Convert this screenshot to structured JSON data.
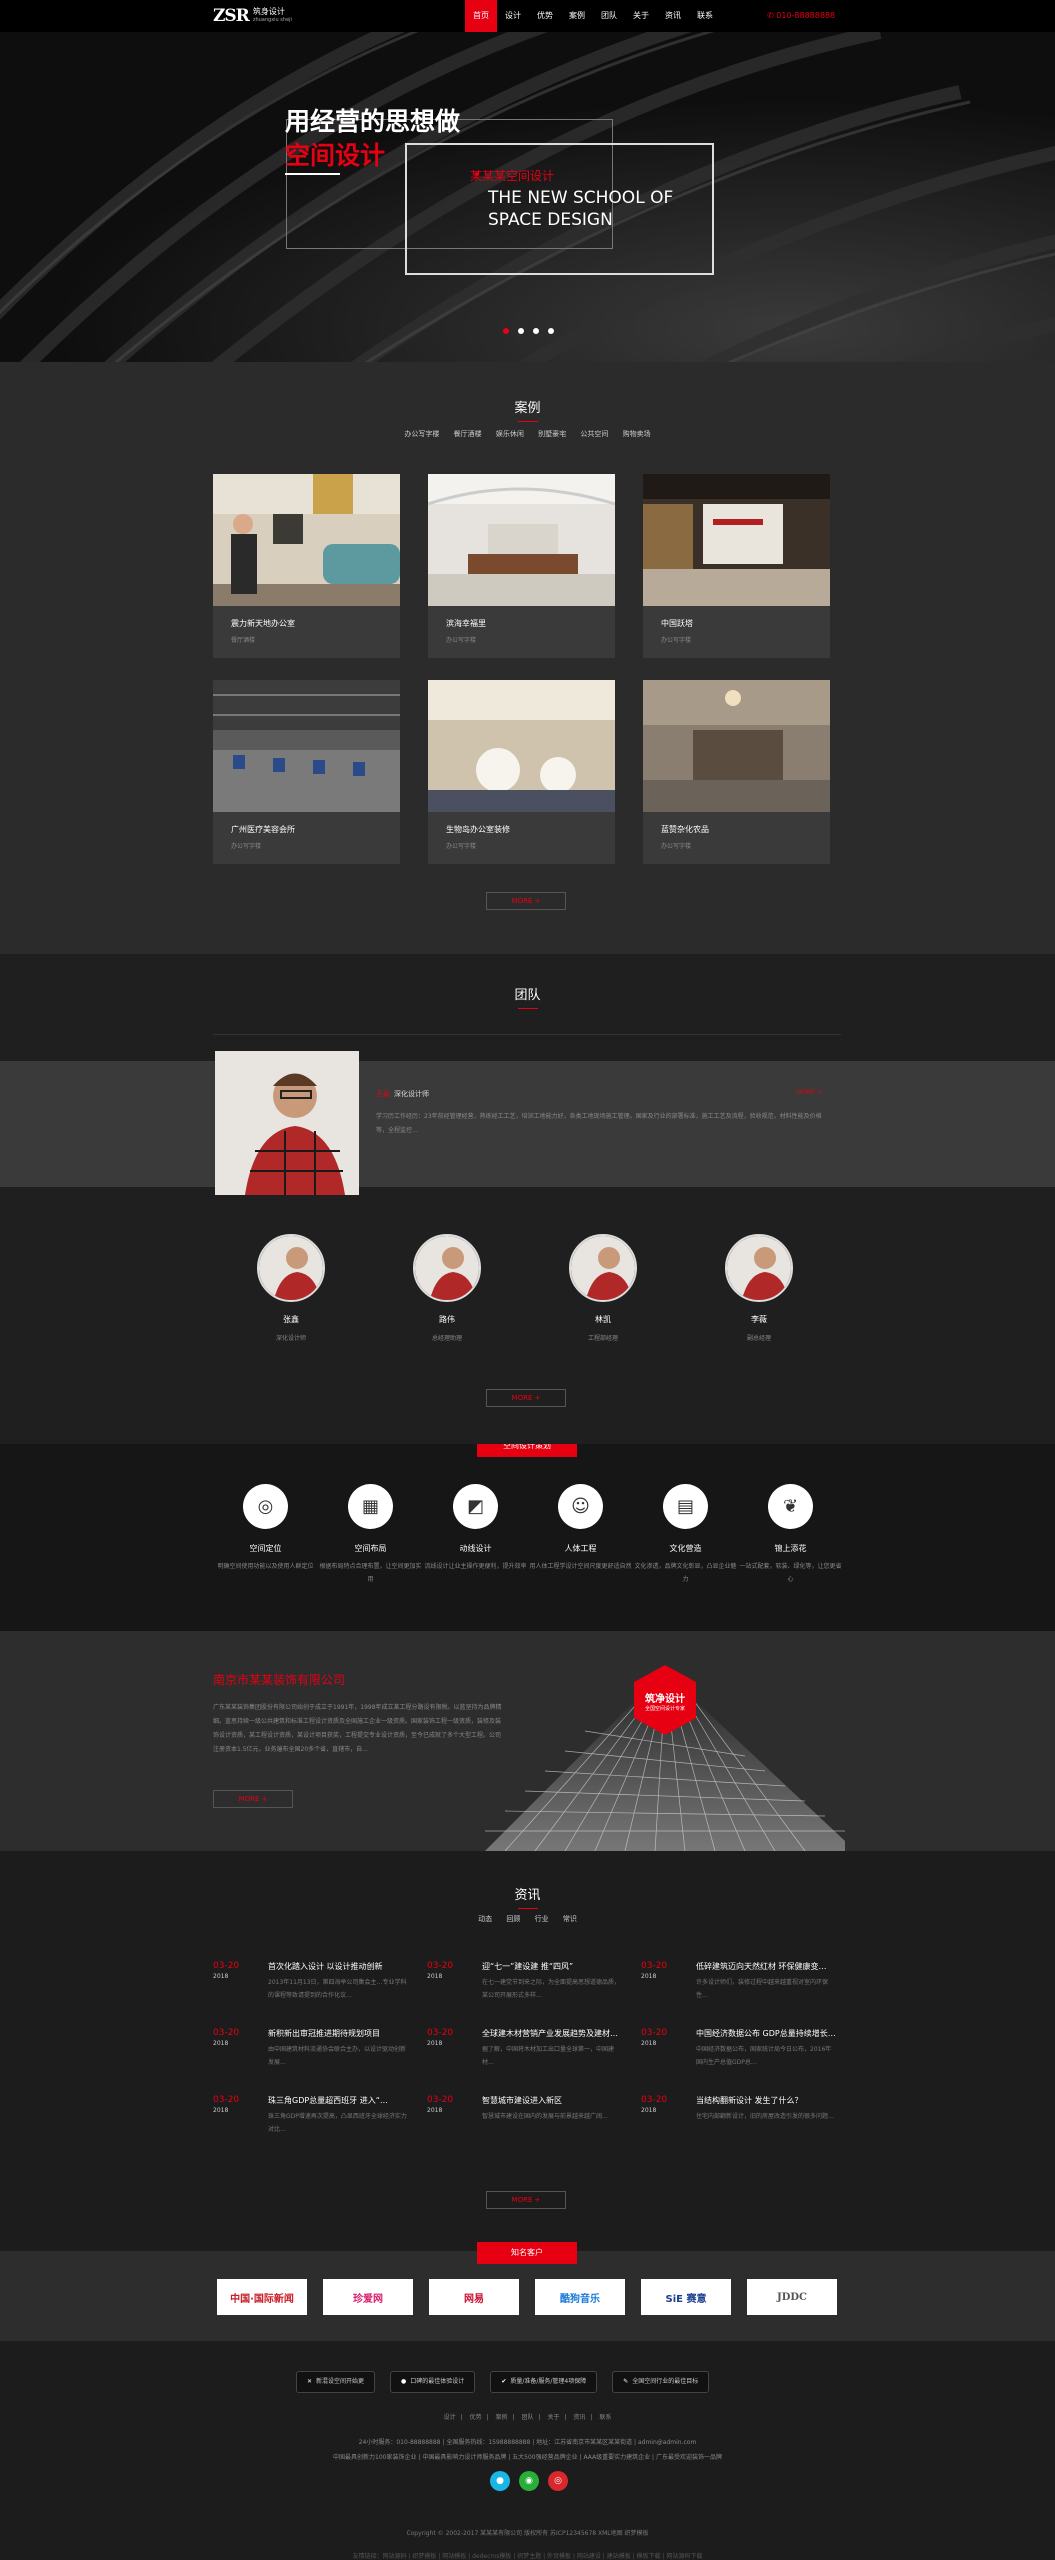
{
  "header": {
    "logo_mark": "ZSR",
    "logo_cn": "筑身设计",
    "logo_en": "zhuangxiu sheji",
    "nav": [
      "首页",
      "设计",
      "优势",
      "案例",
      "团队",
      "关于",
      "资讯",
      "联系"
    ],
    "phone": "010-88888888"
  },
  "banner": {
    "title": "用经营的思想做",
    "title_red": "空间设计",
    "tag_cn": "某某某空间设计",
    "en_line1": "THE NEW SCHOOL OF",
    "en_line2": "SPACE DESIGN"
  },
  "cases": {
    "title": "案例",
    "tabs": [
      "办公写字楼",
      "餐厅酒楼",
      "娱乐休闲",
      "别墅豪宅",
      "公共空间",
      "购物卖场"
    ],
    "items": [
      {
        "title": "震力新天地办公室",
        "sub": "餐厅酒楼"
      },
      {
        "title": "滨海幸福里",
        "sub": "办公写字楼"
      },
      {
        "title": "中国跃塔",
        "sub": "办公写字楼"
      },
      {
        "title": "广州医疗美容会所",
        "sub": "办公写字楼"
      },
      {
        "title": "生物岛办公室装修",
        "sub": "办公写字楼"
      },
      {
        "title": "蓝赞杂化农品",
        "sub": "办公写字楼"
      }
    ],
    "more": "MORE +"
  },
  "team": {
    "title": "团队",
    "leader": {
      "name": "王淼",
      "role": "深化设计师",
      "more": "MORE +",
      "desc": "学习历工作经历：23年前经管理经营，熟练经工工艺，培训工地能力好，各类工地现场施工管理。国家及行业的部署标准，施工工艺及流程，验收规范，材料性能及价格等，全程监控..."
    },
    "members": [
      {
        "name": "张鑫",
        "role": "深化设计师"
      },
      {
        "name": "路伟",
        "role": "总经理助理"
      },
      {
        "name": "林凯",
        "role": "工程部经理"
      },
      {
        "name": "李薇",
        "role": "副总经理"
      }
    ],
    "more": "MORE +"
  },
  "planning": {
    "badge": "空间设计策划",
    "items": [
      {
        "icon": "target-icon",
        "glyph": "◎",
        "title": "空间定位",
        "desc": "明确空间使用功能以及使用人群定位"
      },
      {
        "icon": "layout-icon",
        "glyph": "▦",
        "title": "空间布局",
        "desc": "根据布局特点合理布置，让空间更加实用"
      },
      {
        "icon": "puzzle-icon",
        "glyph": "◩",
        "title": "动线设计",
        "desc": "流线设计让业主操作更便利，提升效率"
      },
      {
        "icon": "person-icon",
        "glyph": "☺",
        "title": "人体工程",
        "desc": "用人体工程学设计空间尺度更舒适自然"
      },
      {
        "icon": "book-icon",
        "glyph": "▤",
        "title": "文化营造",
        "desc": "文化渗透，品牌文化彰显，凸显企业魅力"
      },
      {
        "icon": "leaf-icon",
        "glyph": "❦",
        "title": "锦上添花",
        "desc": "一站式配套，软装、绿化等，让您更省心"
      }
    ]
  },
  "about": {
    "title": "南京市某某装饰有限公司",
    "text": "广东某某装饰集团股份有限公司始创于成立于1991年，1998年成立某工程分路设有限税。以蓝坚持为品牌精细。蓝思持续一级公共建筑和标准工程设计资质及全国施工企业一级资质。国家装饰工程一级资质，装修及装饰设计资质，某工程设计资质，某设计项目获奖，工程提交专业设计资质，至今已成就了多个大型工程。公司注册资本1.5亿元，业务遍布全国20多个省，直辖市，自...",
    "more": "MORE +",
    "hex_title": "筑净设计",
    "hex_sub": "全国空间设计专家"
  },
  "news": {
    "title": "资讯",
    "tabs": [
      "动态",
      "回顾",
      "行业",
      "常识"
    ],
    "items": [
      {
        "date": "03-20",
        "year": "2018",
        "title": "首次化踏入设计 以设计推动创新",
        "desc": "2013年11月13日，第四海举公司集会主…专业学科的课程等致请提到的合作化议…"
      },
      {
        "date": "03-20",
        "year": "2018",
        "title": "迎“七一”建设建 推“四风”",
        "desc": "在七一建党节到来之际，为全面提高思想道德品质，某公司开展形式多样…"
      },
      {
        "date": "03-20",
        "year": "2018",
        "title": "低碎建筑迈向天然红材 环保健康变…",
        "desc": "许多设计师们，装修过程中越来越重视对室内环保性…"
      },
      {
        "date": "03-20",
        "year": "2018",
        "title": "新积新出审冠推进期待规划项目",
        "desc": "由中国建筑材料流通协会联合主办，以设计驱动创新发展…"
      },
      {
        "date": "03-20",
        "year": "2018",
        "title": "全球建木材营销产业发展趋势及建材…",
        "desc": "据了解，中国将木材加工出口量全球第一，中国建材…"
      },
      {
        "date": "03-20",
        "year": "2018",
        "title": "中国经济数据公布 GDP总量持续增长…",
        "desc": "中国经济数据公布，国家统计局今日公布，2016年国内生产总值GDP总…"
      },
      {
        "date": "03-20",
        "year": "2018",
        "title": "珠三角GDP总量超西班牙 进入“…",
        "desc": "珠三角GDP增速再次提高，凸显西班牙全球经济实力对比…"
      },
      {
        "date": "03-20",
        "year": "2018",
        "title": "智慧城市建设进入新区",
        "desc": "智慧城市建设在国内的发展与前景越来越广阔…"
      },
      {
        "date": "03-20",
        "year": "2018",
        "title": "当结构翻新设计 发生了什么？",
        "desc": "住宅内部翻新设计，旧的房屋改造引发的很多问题…"
      }
    ],
    "more": "MORE +"
  },
  "clients": {
    "badge": "知名客户",
    "logos": [
      "中国·国际新闻",
      "珍爱网",
      "网易",
      "酷狗音乐",
      "SiE 赛意",
      "JDDC"
    ]
  },
  "footer": {
    "buttons": [
      {
        "icon": "✕",
        "label": "新混设空间开始更"
      },
      {
        "icon": "●",
        "label": "口碑的最佳体验设计"
      },
      {
        "icon": "✔",
        "label": "质量/准备/服务/管理4项保障"
      },
      {
        "icon": "✎",
        "label": "全国空间行业的最佳目标"
      }
    ],
    "nav": [
      "设计",
      "优势",
      "案例",
      "团队",
      "关于",
      "资讯",
      "联系"
    ],
    "info1": "24小时服务：010-88888888 | 全国服务热线：15988888888 | 地址：江苏省南京市某某区某某街道 | admin@admin.com",
    "info2": "中国最具创新力100家装饰企业 | 中国最具影响力设计师服务品牌 | 五大500强经营品牌企业 | AAA级重要实力建筑企业 | 广东最受欢迎装饰一品牌",
    "copyright": "Copyright © 2002-2017 某某某有限公司 版权所有 苏ICP12345678 XML地图 织梦模板",
    "links": "友情链接：网站源码 | 织梦模板 | 网站模板 | dedecms模板 | 织梦主题 | 外贸模板 | 网站建设 | 建站模板 | 模板下载 | 网站源码下载"
  }
}
